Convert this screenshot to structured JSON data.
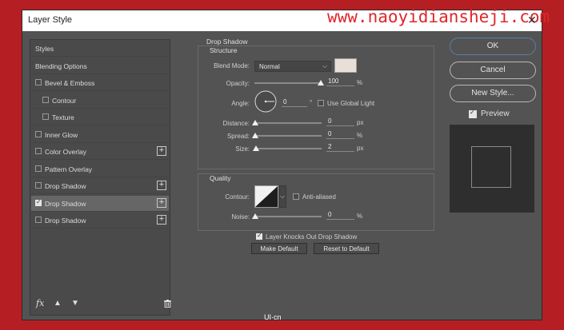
{
  "window": {
    "title": "Layer Style",
    "watermark": "www.naoyidiansheji.com",
    "close_glyph": "✕"
  },
  "styles_panel": {
    "items": [
      {
        "label": "Styles",
        "checkbox": false,
        "checked": false,
        "plus": false,
        "selected": false,
        "indent": 0
      },
      {
        "label": "Blending Options",
        "checkbox": false,
        "checked": false,
        "plus": false,
        "selected": false,
        "indent": 0
      },
      {
        "label": "Bevel & Emboss",
        "checkbox": true,
        "checked": false,
        "plus": false,
        "selected": false,
        "indent": 0
      },
      {
        "label": "Contour",
        "checkbox": true,
        "checked": false,
        "plus": false,
        "selected": false,
        "indent": 1
      },
      {
        "label": "Texture",
        "checkbox": true,
        "checked": false,
        "plus": false,
        "selected": false,
        "indent": 1
      },
      {
        "label": "Inner Glow",
        "checkbox": true,
        "checked": false,
        "plus": false,
        "selected": false,
        "indent": 0
      },
      {
        "label": "Color Overlay",
        "checkbox": true,
        "checked": false,
        "plus": true,
        "selected": false,
        "indent": 0
      },
      {
        "label": "Pattern Overlay",
        "checkbox": true,
        "checked": false,
        "plus": false,
        "selected": false,
        "indent": 0
      },
      {
        "label": "Drop Shadow",
        "checkbox": true,
        "checked": false,
        "plus": true,
        "selected": false,
        "indent": 0
      },
      {
        "label": "Drop Shadow",
        "checkbox": true,
        "checked": true,
        "plus": true,
        "selected": true,
        "indent": 0
      },
      {
        "label": "Drop Shadow",
        "checkbox": true,
        "checked": false,
        "plus": true,
        "selected": false,
        "indent": 0
      }
    ],
    "footer": {
      "fx": "fx",
      "up_icon": "arrow-up-icon",
      "down_icon": "arrow-down-icon",
      "trash_icon": "trash-icon"
    }
  },
  "drop_shadow": {
    "section_title": "Drop Shadow",
    "structure_title": "Structure",
    "blend_mode_label": "Blend Mode:",
    "blend_mode_value": "Normal",
    "shadow_color": "#e8e0d8",
    "opacity_label": "Opacity:",
    "opacity_value": "100",
    "opacity_unit": "%",
    "angle_label": "Angle:",
    "angle_value": "0",
    "angle_unit": "°",
    "use_global_light_label": "Use Global Light",
    "use_global_light_checked": false,
    "distance_label": "Distance:",
    "distance_value": "0",
    "distance_unit": "px",
    "spread_label": "Spread:",
    "spread_value": "0",
    "spread_unit": "%",
    "size_label": "Size:",
    "size_value": "2",
    "size_unit": "px",
    "quality_title": "Quality",
    "contour_label": "Contour:",
    "anti_aliased_label": "Anti-aliased",
    "anti_aliased_checked": false,
    "noise_label": "Noise:",
    "noise_value": "0",
    "noise_unit": "%",
    "knockout_label": "Layer Knocks Out Drop Shadow",
    "knockout_checked": true,
    "make_default_label": "Make Default",
    "reset_default_label": "Reset to Default"
  },
  "right_panel": {
    "ok_label": "OK",
    "cancel_label": "Cancel",
    "new_style_label": "New Style...",
    "preview_label": "Preview",
    "preview_checked": true
  },
  "logo_text": "UI·cn"
}
